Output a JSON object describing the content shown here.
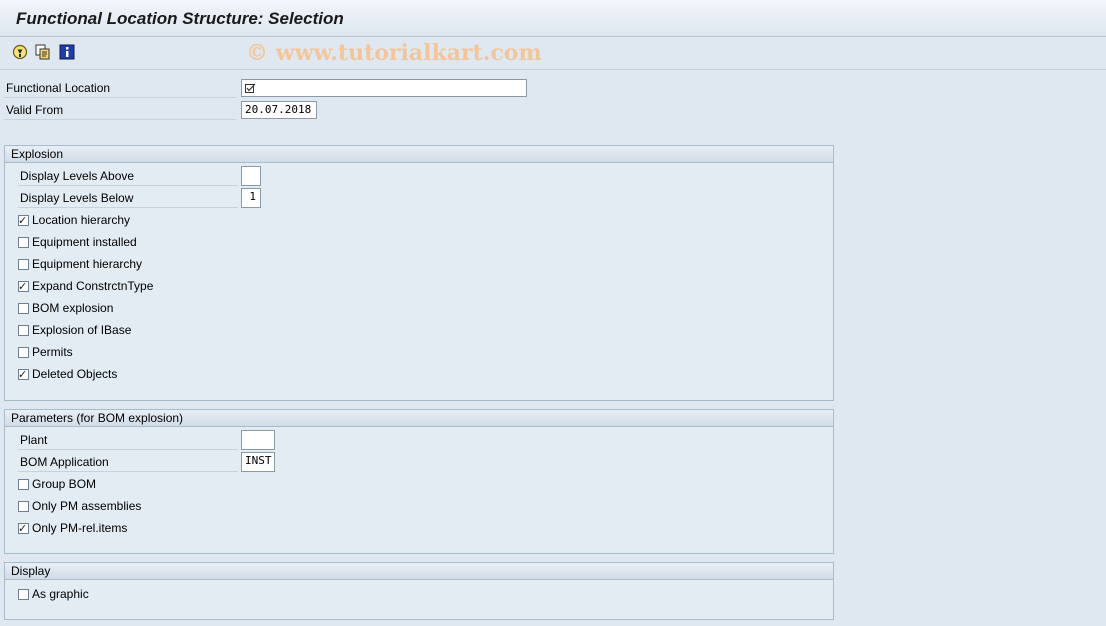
{
  "window": {
    "title": "Functional Location Structure: Selection"
  },
  "toolbar": {
    "buttons": [
      {
        "icon": "execute-icon"
      },
      {
        "icon": "copy-icon"
      },
      {
        "icon": "info-icon"
      }
    ]
  },
  "watermark": "© www.tutorialkart.com",
  "header_fields": {
    "functional_location": {
      "label": "Functional Location",
      "value": ""
    },
    "valid_from": {
      "label": "Valid From",
      "value": "20.07.2018"
    }
  },
  "explosion": {
    "title": "Explosion",
    "levels_above": {
      "label": "Display Levels Above",
      "value": ""
    },
    "levels_below": {
      "label": "Display Levels Below",
      "value": "1"
    },
    "options": [
      {
        "label": "Location hierarchy",
        "checked": true
      },
      {
        "label": "Equipment installed",
        "checked": false
      },
      {
        "label": "Equipment hierarchy",
        "checked": false
      },
      {
        "label": "Expand ConstrctnType",
        "checked": true
      },
      {
        "label": "BOM explosion",
        "checked": false
      },
      {
        "label": "Explosion of IBase",
        "checked": false
      },
      {
        "label": "Permits",
        "checked": false
      },
      {
        "label": "Deleted Objects",
        "checked": true
      }
    ]
  },
  "parameters": {
    "title": "Parameters (for BOM explosion)",
    "plant": {
      "label": "Plant",
      "value": ""
    },
    "bom_application": {
      "label": "BOM Application",
      "value": "INST"
    },
    "options": [
      {
        "label": "Group BOM",
        "checked": false
      },
      {
        "label": "Only PM assemblies",
        "checked": false
      },
      {
        "label": "Only PM-rel.items",
        "checked": true
      }
    ]
  },
  "display": {
    "title": "Display",
    "options": [
      {
        "label": "As graphic",
        "checked": false
      }
    ]
  }
}
